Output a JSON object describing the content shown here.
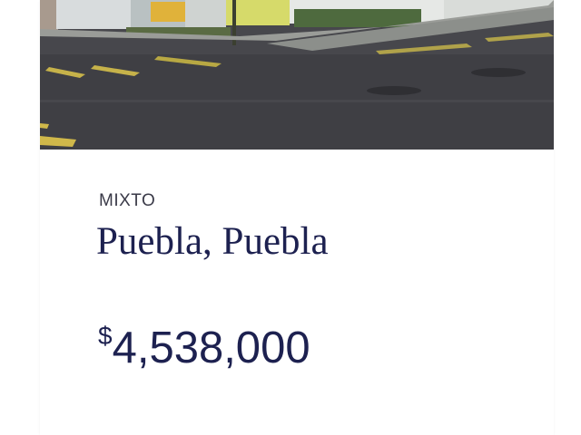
{
  "listing": {
    "category": "MIXTO",
    "location": "Puebla, Puebla",
    "price": {
      "currency_symbol": "$",
      "amount": "4,538,000"
    }
  },
  "colors": {
    "title_text": "#1d2150",
    "category_text": "#3a3a48",
    "card_background": "#ffffff"
  }
}
